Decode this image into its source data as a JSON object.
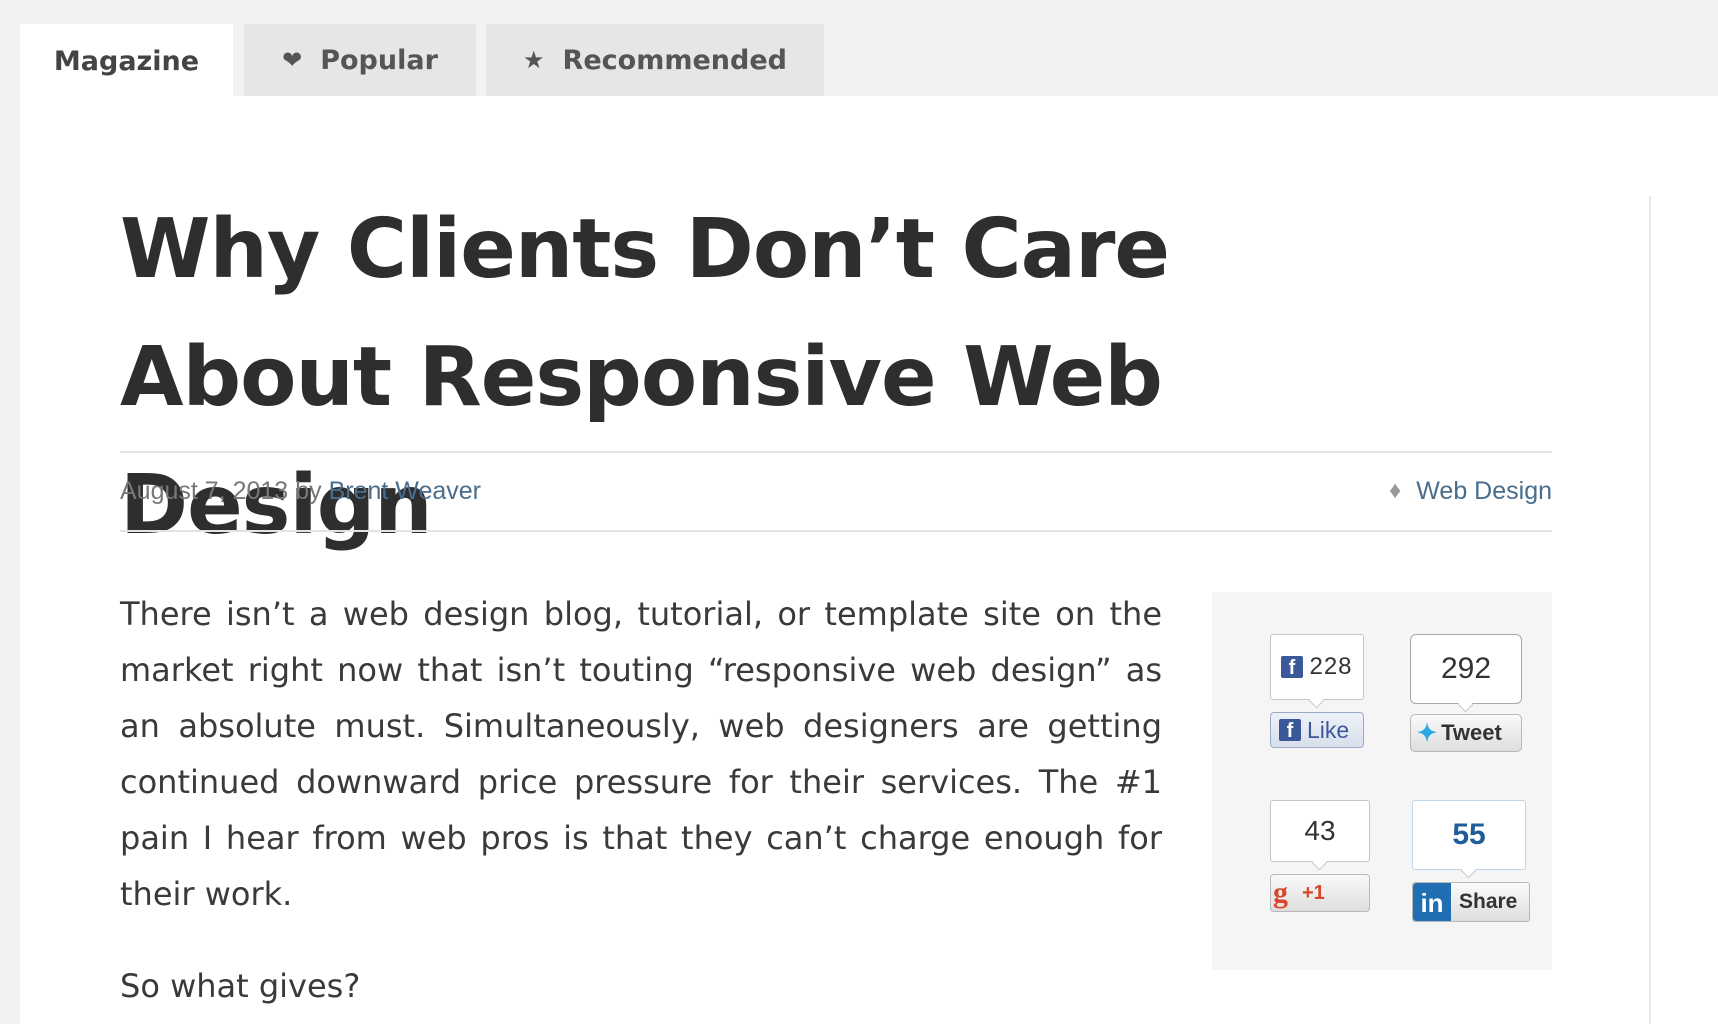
{
  "tabs": [
    {
      "label": "Magazine",
      "icon": "",
      "active": true
    },
    {
      "label": "Popular",
      "icon": "heart-icon",
      "active": false
    },
    {
      "label": "Recommended",
      "icon": "star-icon",
      "active": false
    }
  ],
  "article": {
    "title": "Why Clients Don’t Care About Responsive Web Design",
    "date": "August 7, 2013",
    "by": "by",
    "author": "Brent Weaver",
    "category": "Web Design",
    "paragraphs": [
      "There isn’t a web design blog, tutorial, or template site on the market right now that isn’t touting “responsive web design” as an absolute must. Simultaneously, web designers are getting continued downward price pressure for their services. The #1 pain I hear from web pros is that they can’t charge enough for their work.",
      "So what gives?"
    ]
  },
  "share": {
    "facebook": {
      "count": "228",
      "label": "Like",
      "icon": "f"
    },
    "twitter": {
      "count": "292",
      "label": "Tweet"
    },
    "googleplus": {
      "count": "43",
      "label": "+1",
      "icon": "g"
    },
    "linkedin": {
      "count": "55",
      "label": "Share",
      "icon": "in"
    }
  },
  "colors": {
    "link": "#4a6d8c",
    "facebook": "#3b5998",
    "twitter": "#2aa9e0",
    "googleplus": "#d8472b",
    "linkedin": "#1f6fb2"
  }
}
